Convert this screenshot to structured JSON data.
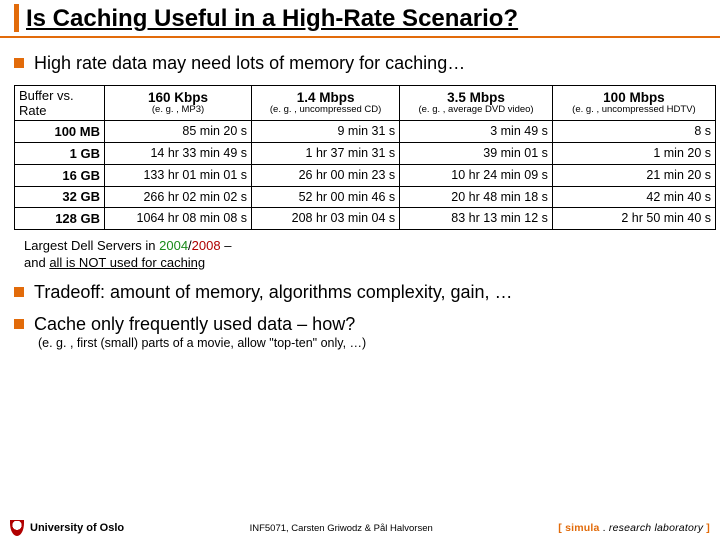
{
  "title": "Is Caching Useful in a High-Rate Scenario?",
  "bullets": {
    "b1": "High rate data may need lots of memory for caching…",
    "b2": "Tradeoff: amount of memory, algorithms complexity, gain, …",
    "b3": "Cache only frequently used data – how?",
    "b3_sub": "(e. g. , first (small) parts of a movie, allow \"top-ten\" only, …)"
  },
  "table": {
    "corner": "Buffer vs. Rate",
    "cols": [
      {
        "rate": "160 Kbps",
        "eg": "(e. g. , MP3)"
      },
      {
        "rate": "1.4 Mbps",
        "eg": "(e. g. , uncompressed CD)"
      },
      {
        "rate": "3.5 Mbps",
        "eg": "(e. g. , average DVD video)"
      },
      {
        "rate": "100 Mbps",
        "eg": "(e. g. , uncompressed HDTV)"
      }
    ],
    "rows": [
      {
        "label": "100 MB",
        "cells": [
          "85 min 20 s",
          "9 min 31 s",
          "3 min 49 s",
          "8 s"
        ]
      },
      {
        "label": "1 GB",
        "cells": [
          "14 hr 33 min 49 s",
          "1 hr 37 min 31 s",
          "39 min 01 s",
          "1 min 20 s"
        ]
      },
      {
        "label": "16 GB",
        "cells": [
          "133 hr 01 min 01 s",
          "26 hr 00 min 23 s",
          "10 hr 24 min 09 s",
          "21 min 20 s"
        ]
      },
      {
        "label": "32 GB",
        "cells": [
          "266 hr 02 min 02 s",
          "52 hr 00 min 46 s",
          "20 hr 48 min 18 s",
          "42 min 40 s"
        ]
      },
      {
        "label": "128 GB",
        "cells": [
          "1064 hr 08 min 08 s",
          "208 hr 03 min 04 s",
          "83 hr 13 min 12 s",
          "2 hr 50 min 40 s"
        ]
      }
    ]
  },
  "note": {
    "pre": "Largest Dell Servers in ",
    "year1": "2004",
    "slash": "/",
    "year2": "2008",
    "post1": " – ",
    "post2": "and ",
    "under": "all is NOT used for caching"
  },
  "footer": {
    "uio": "University of Oslo",
    "mid": "INF5071, Carsten Griwodz & Pål Halvorsen",
    "right": {
      "b_open": "[ ",
      "sim": "simula",
      "dot": " . ",
      "res": "research laboratory",
      "b_close": " ]"
    }
  }
}
